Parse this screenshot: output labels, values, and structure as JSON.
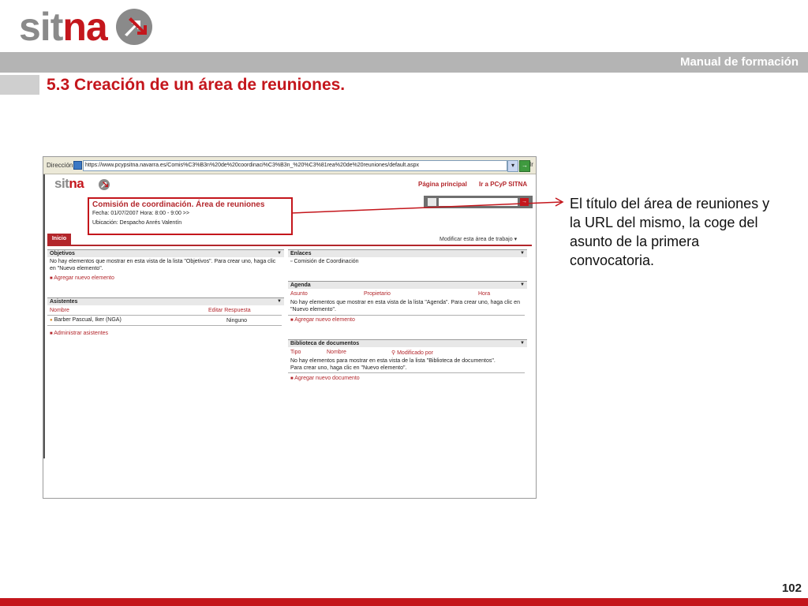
{
  "slide": {
    "logo_sit": "sit",
    "logo_na": "na",
    "manual_label": "Manual de formación",
    "title": "5.3 Creación de un área de reuniones.",
    "annotation": "El título del área de reuniones y la URL del mismo, la coge del asunto de la primera convocatoria.",
    "page_number": "102"
  },
  "browser": {
    "address_label": "Dirección",
    "url": "https://www.pcypsitna.navarra.es/Comis%C3%B3n%20de%20coordinaci%C3%B3n_%20%C3%81rea%20de%20reuniones/default.aspx",
    "go_label": "Ir"
  },
  "site": {
    "logo_sit": "sit",
    "logo_na": "na",
    "top_links": [
      "Página principal",
      "Ir a PCyP SITNA"
    ],
    "title": "Comisión de coordinación. Área de reuniones",
    "meeting_date_line": "Fecha: 01/07/2007 Hora: 8:00 - 9:00  >>",
    "meeting_location_line": "Ubicación: Despacho Anrés Valentín",
    "tab_inicio": "Inicio",
    "modify_link": "Modificar esta área de trabajo"
  },
  "webparts": {
    "objetivos": {
      "title": "Objetivos",
      "empty_text": "No hay elementos que mostrar en esta vista de la lista \"Objetivos\". Para crear uno, haga clic en \"Nuevo elemento\".",
      "add_link": "Agregar nuevo elemento"
    },
    "asistentes": {
      "title": "Asistentes",
      "col_nombre": "Nombre",
      "col_respuesta": "Editar Respuesta",
      "row_name": "Barber Pascual, Iker (NGA)",
      "row_response": "Ninguno",
      "admin_link": "Administrar asistentes"
    },
    "enlaces": {
      "title": "Enlaces",
      "item": "Comisión de Coordinación"
    },
    "agenda": {
      "title": "Agenda",
      "col_asunto": "Asunto",
      "col_propietario": "Propietario",
      "col_hora": "Hora",
      "empty_text": "No hay elementos que mostrar en esta vista de la lista \"Agenda\". Para crear uno, haga clic en \"Nuevo elemento\".",
      "add_link": "Agregar nuevo elemento"
    },
    "biblioteca": {
      "title": "Biblioteca de documentos",
      "col_tipo": "Tipo",
      "col_nombre": "Nombre",
      "col_modificado": "Modificado por",
      "empty_text": "No hay elementos para mostrar en esta vista de la lista \"Biblioteca de documentos\". Para crear uno, haga clic en \"Nuevo elemento\".",
      "add_link": "Agregar nuevo documento"
    }
  },
  "colors": {
    "brand_red": "#c4161c",
    "brand_grey": "#8a8a8a",
    "header_bar": "#b4b4b4"
  }
}
